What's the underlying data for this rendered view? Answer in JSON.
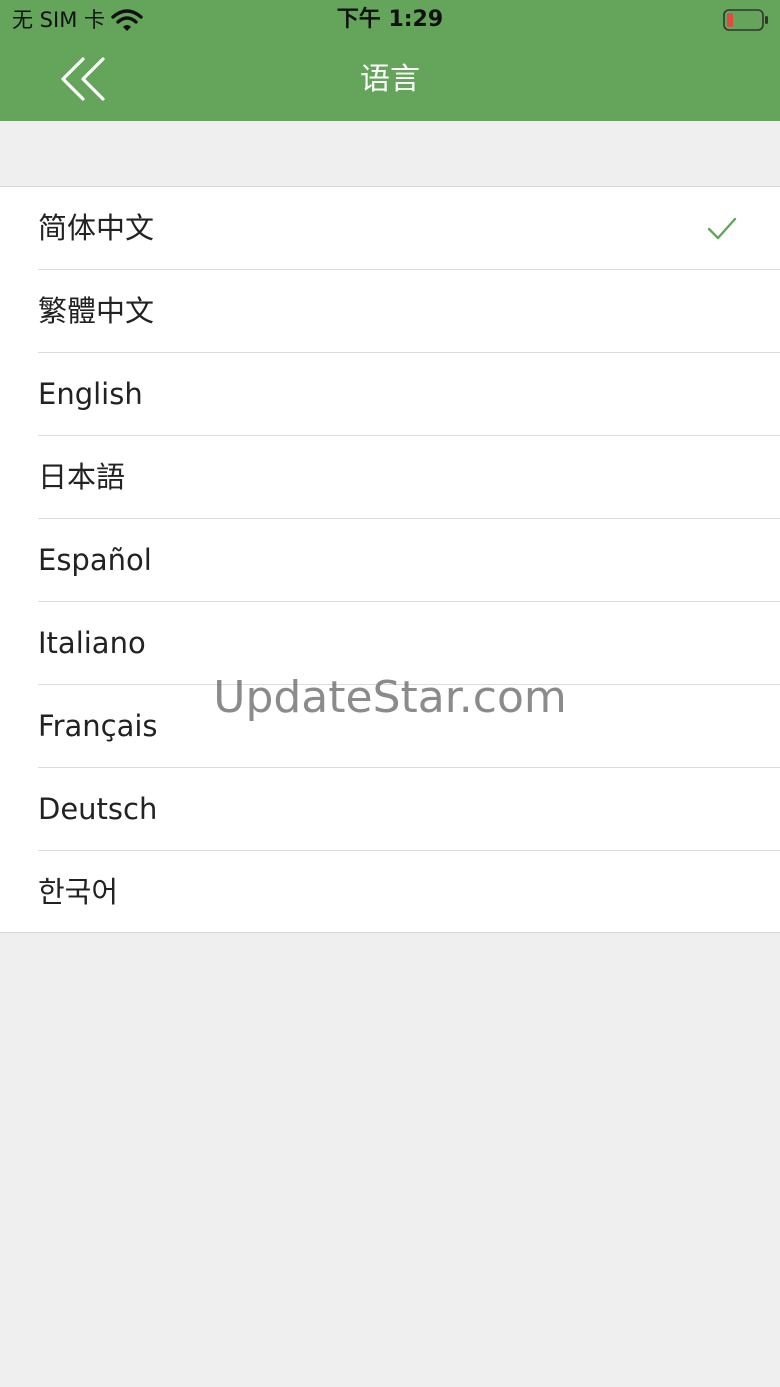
{
  "status_bar": {
    "carrier": "无 SIM 卡",
    "time": "下午 1:29",
    "battery_color": "#e04a3f"
  },
  "nav": {
    "title": "语言",
    "back_icon": "double-chevron-left-icon",
    "bar_color": "#64a55b"
  },
  "languages": [
    {
      "label": "简体中文",
      "selected": true
    },
    {
      "label": "繁體中文",
      "selected": false
    },
    {
      "label": "English",
      "selected": false
    },
    {
      "label": "日本語",
      "selected": false
    },
    {
      "label": "Español",
      "selected": false
    },
    {
      "label": "Italiano",
      "selected": false
    },
    {
      "label": "Français",
      "selected": false
    },
    {
      "label": "Deutsch",
      "selected": false
    },
    {
      "label": "한국어",
      "selected": false
    }
  ],
  "check_color": "#5fa85a",
  "watermark": "UpdateStar.com"
}
